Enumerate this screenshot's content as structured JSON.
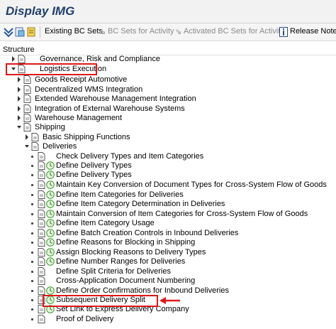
{
  "window": {
    "title": "Display IMG"
  },
  "toolbar": {
    "existing_bc_sets": "Existing BC Sets",
    "bc_sets_for_activity": "BC Sets for Activity",
    "activated_bc_sets_for_activity": "Activated BC Sets for Activity",
    "release_notes": "Release Notes"
  },
  "tree": {
    "header": "Structure",
    "governance": "Governance, Risk and Compliance",
    "logistics_execution": "Logistics Execution",
    "goods_receipt_automotive": "Goods Receipt Automotive",
    "decentralized_wms": "Decentralized WMS Integration",
    "extended_wm": "Extended Warehouse Management Integration",
    "integration_external_wh": "Integration of External Warehouse Systems",
    "warehouse_management": "Warehouse Management",
    "shipping": "Shipping",
    "basic_shipping": "Basic Shipping Functions",
    "deliveries": "Deliveries",
    "delivery_items": [
      "Check Delivery Types and Item Categories",
      "Define Delivery Types",
      "Define Delivery Types",
      "Maintain Key Conversion of Document Types for Cross-System Flow of Goods",
      "Define Item Categories for Deliveries",
      "Define Item Category Determination in Deliveries",
      "Maintain Conversion of Item Categories for Cross-System Flow of Goods",
      "Define Item Category Usage",
      "Define Batch Creation Controls in Inbound Deliveries",
      "Define Reasons for Blocking in Shipping",
      "Assign Blocking Reasons to Delivery Types",
      "Define Number Ranges for Deliveries",
      "Define Split Criteria for Deliveries",
      "Cross-Application Document Numbering",
      "Define Order Confirmations for Inbound Deliveries",
      "Subsequent Delivery Split",
      "Set Link to Express Delivery Company",
      "Proof of Delivery"
    ]
  },
  "colors": {
    "highlight": "#e01818",
    "title": "#1f3f6a",
    "activity": "#3a9a2a"
  }
}
